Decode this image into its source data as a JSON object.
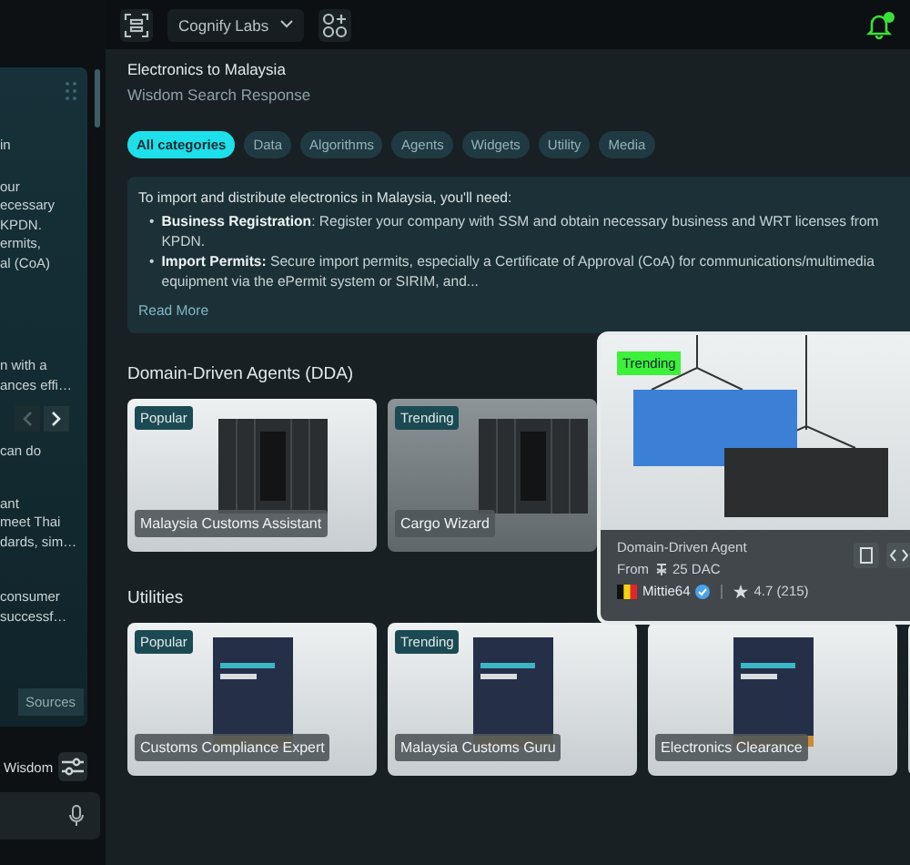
{
  "chat": {
    "groups": [
      {
        "lines": [
          "in"
        ]
      },
      {
        "lines": [
          "our",
          "ecessary",
          "KPDN.",
          "ermits,",
          "al (CoA)"
        ]
      },
      {
        "lines": [
          "n with a",
          "ances effi…"
        ]
      },
      {
        "lines": [
          "can do"
        ]
      },
      {
        "lines": [
          "ant",
          "meet Thai",
          "dards, sim…"
        ]
      },
      {
        "lines": [
          "consumer",
          "successf…"
        ]
      }
    ],
    "carousel": {
      "prev_disabled": true,
      "next_disabled": false
    },
    "sources_button": "Sources",
    "mode_label": "Wisdom"
  },
  "topbar": {
    "workspace": "Cognify Labs",
    "notifications": true
  },
  "header": {
    "title": "Electronics to Malaysia",
    "subtitle": "Wisdom Search Response"
  },
  "chips": [
    {
      "label": "All categories",
      "selected": true
    },
    {
      "label": "Data",
      "selected": false
    },
    {
      "label": "Algorithms",
      "selected": false
    },
    {
      "label": "Agents",
      "selected": false
    },
    {
      "label": "Widgets",
      "selected": false
    },
    {
      "label": "Utility",
      "selected": false
    },
    {
      "label": "Media",
      "selected": false
    }
  ],
  "answer": {
    "intro": "To import and distribute electronics in Malaysia, you'll need:",
    "bullets": [
      {
        "marker": "•",
        "text": "**Business Registration**: Register your company with SSM and obtain necessary business and WRT licenses from KPDN."
      },
      {
        "marker": "•",
        "text": "**Import Permits:** Secure import permits, especially a Certificate of Approval (CoA) for communications/multimedia equipment via the ePermit system or SIRIM, and..."
      }
    ],
    "read_more": "Read More"
  },
  "agents": {
    "title": "Domain-Driven Agents (DDA)",
    "cards": [
      {
        "badge": "Popular",
        "title": "Malaysia Customs Assistant"
      },
      {
        "badge": "Trending",
        "title": "Cargo  Wizard"
      }
    ],
    "preview": {
      "badge": "Trending",
      "type": "Domain-Driven Agent",
      "price_prefix": "From",
      "price": "25 DAC",
      "author": "Mittie64",
      "verified": true,
      "rating": "4.7 (215)"
    }
  },
  "utilities": {
    "title": "Utilities",
    "cards": [
      {
        "badge": "Popular",
        "title": "Customs Compliance Expert"
      },
      {
        "badge": "Trending",
        "title": "Malaysia Customs Guru"
      },
      {
        "title": "Electronics Clearance"
      }
    ]
  }
}
